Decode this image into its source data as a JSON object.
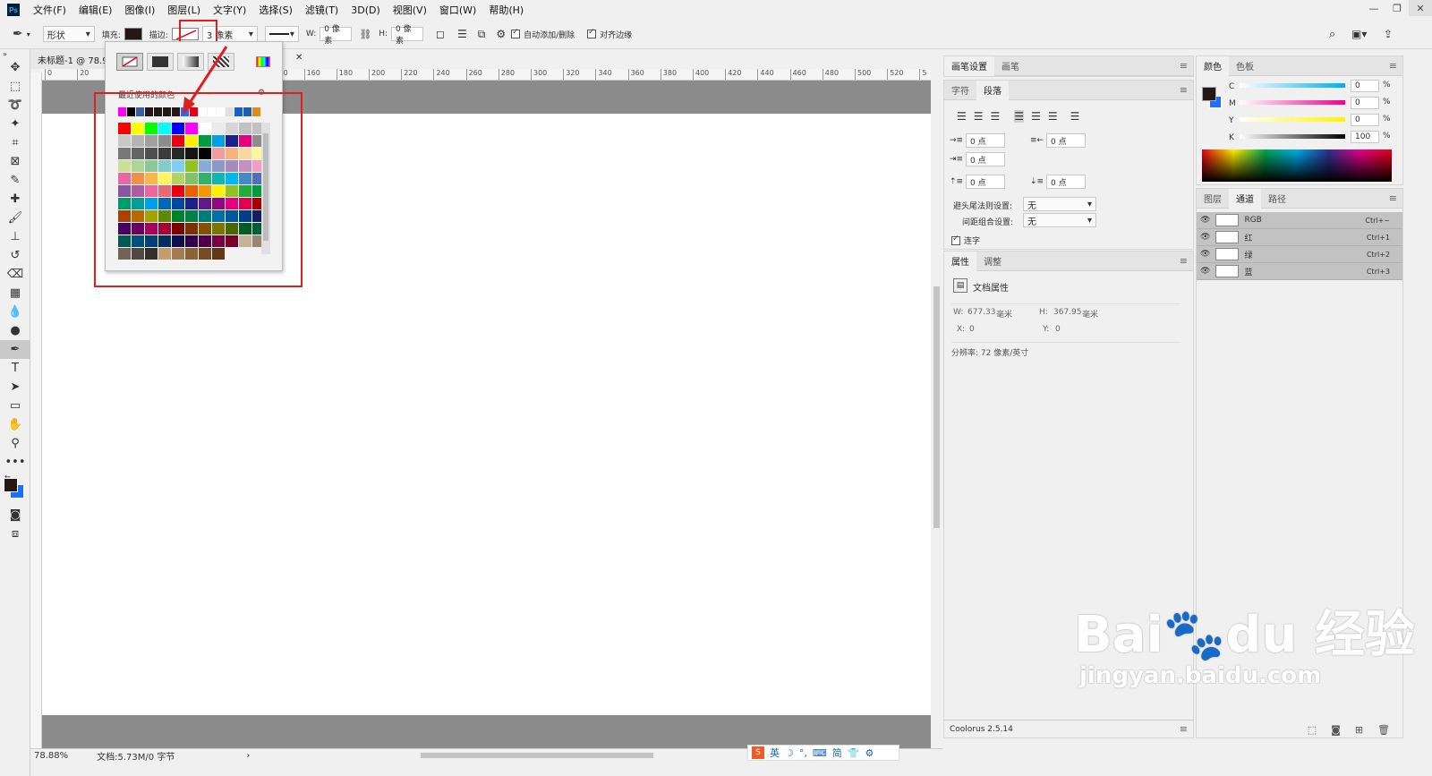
{
  "app": {
    "logo": "Ps"
  },
  "menu": [
    "文件(F)",
    "编辑(E)",
    "图像(I)",
    "图层(L)",
    "文字(Y)",
    "选择(S)",
    "滤镜(T)",
    "3D(D)",
    "视图(V)",
    "窗口(W)",
    "帮助(H)"
  ],
  "window_buttons": [
    "—",
    "❐",
    "✕"
  ],
  "options": {
    "mode": "形状",
    "fill_label": "填充:",
    "stroke_label": "描边:",
    "stroke_width": "3 像素",
    "w_label": "W:",
    "w_value": "0 像素",
    "h_label": "H:",
    "h_value": "0 像素",
    "auto_add": "自动添加/删除",
    "align_edges": "对齐边缘",
    "fill_color": "#231815"
  },
  "document": {
    "tab_title": "未标题-1 @ 78.9",
    "zoom": "78.88%",
    "doc_info": "文档:5.73M/0 字节"
  },
  "ruler_ticks": [
    "0",
    "20",
    "40",
    "60",
    "80",
    "100",
    "120",
    "140",
    "160",
    "180",
    "200",
    "220",
    "240",
    "260",
    "280",
    "300",
    "320",
    "340",
    "360",
    "380",
    "400",
    "420",
    "440",
    "460",
    "480",
    "500",
    "520",
    "5"
  ],
  "popup": {
    "recent_label": "最近使用的颜色",
    "recent_colors": [
      "#ff00ff",
      "#000000",
      "#3a5fa0",
      "#231815",
      "#231815",
      "#231815",
      "#231815",
      "#1e6fff",
      "#e60012",
      "#ffffff",
      "#ffffff",
      "#ffffff",
      "#e0e0e0",
      "#1565c0",
      "#1e5bb0",
      "#e08a20"
    ],
    "top_colors": [
      "#ff0000",
      "#ffff00",
      "#00ff00",
      "#00ffff",
      "#0000ff",
      "#ff00ff",
      "#ffffff",
      "#ebebeb",
      "#d6d6d6",
      "#c2c2c2"
    ],
    "colors": [
      "#c8c8c8",
      "#b4b4b4",
      "#a0a0a0",
      "#8c8c8c",
      "#e60012",
      "#fff100",
      "#009944",
      "#00a0e9",
      "#1d2088",
      "#e4007f",
      "#8c8c8c",
      "#787878",
      "#646464",
      "#505050",
      "#3c3c3c",
      "#282828",
      "#141414",
      "#000000",
      "#f29c9f",
      "#f6b37f",
      "#fad89c",
      "#fff799",
      "#cce198",
      "#acd598",
      "#89c997",
      "#84ccc9",
      "#7ecef4",
      "#8fc31f",
      "#88abda",
      "#8c97cb",
      "#aa89bd",
      "#c490bf",
      "#f19ec2",
      "#ea68a2",
      "#f19149",
      "#f8b551",
      "#fff45c",
      "#b3d465",
      "#80c269",
      "#32b16c",
      "#13b5b1",
      "#00b7ee",
      "#448aca",
      "#556fb5",
      "#8957a1",
      "#ae5da1",
      "#ea68a2",
      "#eb6877",
      "#e60012",
      "#eb6100",
      "#f39800",
      "#fff100",
      "#8fc31f",
      "#22ac38",
      "#009944",
      "#009b6b",
      "#009e96",
      "#00a0e9",
      "#0068b7",
      "#00479d",
      "#1d2088",
      "#601986",
      "#920783",
      "#e4007f",
      "#e5004f",
      "#a40000",
      "#a84200",
      "#b56a00",
      "#a5a100",
      "#5f8a00",
      "#007f2d",
      "#007f49",
      "#007c77",
      "#0070a6",
      "#00569a",
      "#003f87",
      "#171c61",
      "#440062",
      "#6a005f",
      "#a5005b",
      "#a40035",
      "#7a0000",
      "#7c3100",
      "#855000",
      "#7a7600",
      "#486900",
      "#005e21",
      "#005e36",
      "#005b56",
      "#00507b",
      "#003f72",
      "#002e63",
      "#0e0f4c",
      "#310048",
      "#4e0046",
      "#7a0043",
      "#7a0027",
      "#c7b299",
      "#998675",
      "#736357",
      "#534741",
      "#362e2b",
      "#c69c6e",
      "#a67c52",
      "#8c6239",
      "#754c24",
      "#603813"
    ]
  },
  "panels": {
    "brush_tabs": [
      "画笔设置",
      "画笔"
    ],
    "char_tabs": [
      "字符",
      "段落"
    ],
    "para_fields": [
      "0 点",
      "0 点",
      "0 点",
      "0 点",
      "0 点"
    ],
    "avoid_label": "避头尾法则设置:",
    "avoid_value": "无",
    "spacing_label": "间距组合设置:",
    "spacing_value": "无",
    "hyphen_label": "连字",
    "props_tabs": [
      "属性",
      "调整"
    ],
    "doc_props": "文档属性",
    "w_label": "W:",
    "w_value": "677.33",
    "w_unit": "毫米",
    "h_label": "H:",
    "h_value": "367.95",
    "h_unit": "毫米",
    "x_label": "X:",
    "x_value": "0",
    "y_label": "Y:",
    "y_value": "0",
    "resolution": "分辨率: 72 像素/英寸",
    "coolorus": "Coolorus 2.5.14",
    "color_tabs": [
      "颜色",
      "色板"
    ],
    "cmyk": [
      {
        "label": "C",
        "value": "0"
      },
      {
        "label": "M",
        "value": "0"
      },
      {
        "label": "Y",
        "value": "0"
      },
      {
        "label": "K",
        "value": "100"
      }
    ],
    "percent": "%",
    "layer_tabs": [
      "图层",
      "通道",
      "路径"
    ],
    "channels": [
      {
        "name": "RGB",
        "shortcut": "Ctrl+~"
      },
      {
        "name": "红",
        "shortcut": "Ctrl+1"
      },
      {
        "name": "绿",
        "shortcut": "Ctrl+2"
      },
      {
        "name": "蓝",
        "shortcut": "Ctrl+3"
      }
    ]
  },
  "ime": {
    "lang": "英"
  },
  "watermark": {
    "brand": "Bai",
    "brand2": "du",
    "cn": "经验",
    "url": "jingyan.baidu.com"
  }
}
